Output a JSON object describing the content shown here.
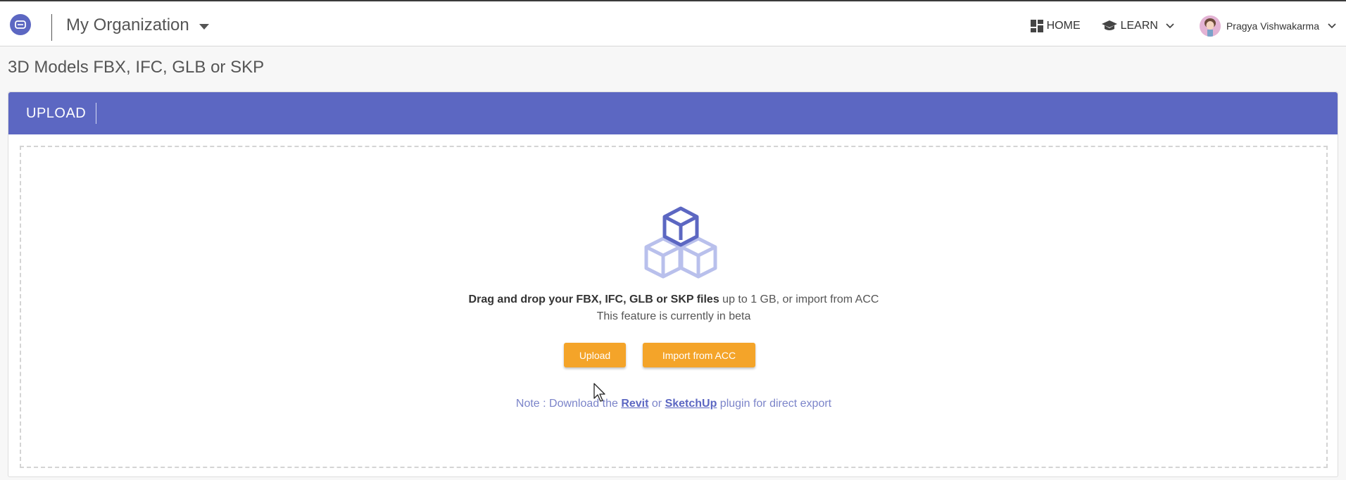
{
  "header": {
    "org_name": "My Organization",
    "nav": {
      "home_label": "HOME",
      "learn_label": "LEARN",
      "user_name": "Pragya Vishwakarma"
    }
  },
  "page": {
    "title": "3D Models FBX, IFC, GLB or SKP"
  },
  "card": {
    "tab_label": "UPLOAD",
    "dropzone": {
      "drag_text_bold": "Drag and drop your FBX, IFC, GLB or SKP files",
      "drag_text_rest": " up to 1 GB, or import from ACC",
      "beta_text": "This feature is currently in beta",
      "upload_button": "Upload",
      "import_button": "Import from ACC",
      "note_prefix": "Note : Download the ",
      "note_revit": "Revit",
      "note_or": " or ",
      "note_sketchup": "SketchUp",
      "note_suffix": " plugin for direct export"
    }
  },
  "colors": {
    "brand": "#5c67c2",
    "accent_button": "#f4a429",
    "cube_light": "#b9c0ec"
  },
  "icons": {
    "app_logo": "app-logo-icon",
    "home": "grid-icon",
    "learn": "graduation-cap-icon",
    "chevron": "chevron-down-icon",
    "cubes": "cubes-icon"
  }
}
